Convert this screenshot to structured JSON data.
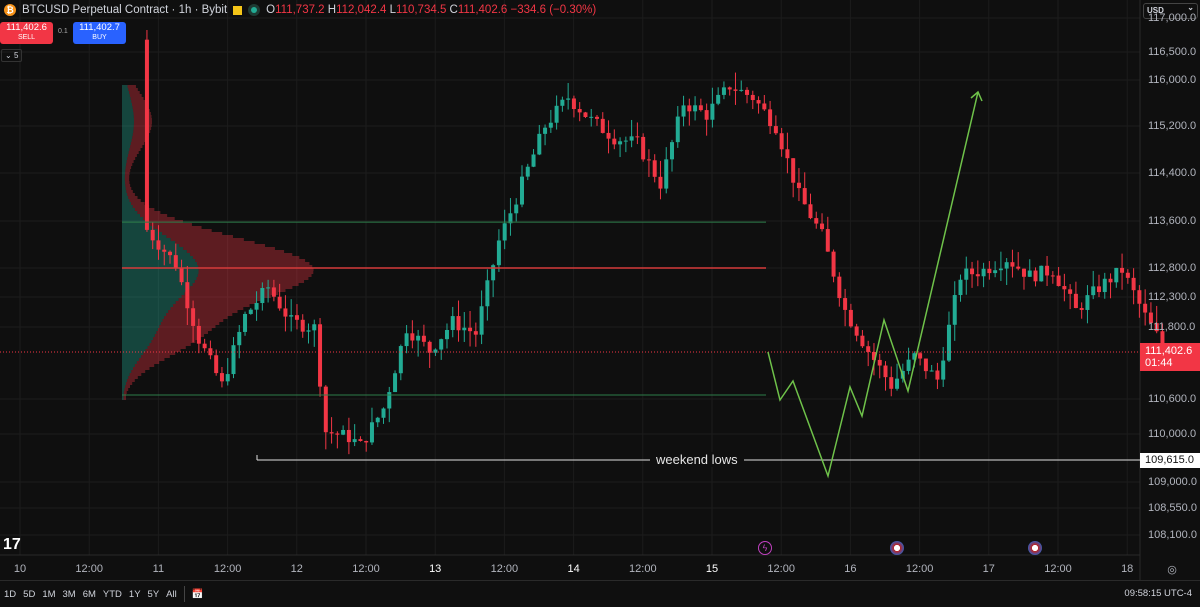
{
  "header": {
    "symbol": "BTCUSD Perpetual Contract · 1h · Bybit",
    "coin_glyph": "₿",
    "o_label": "O",
    "o": "111,737.2",
    "h_label": "H",
    "h": "112,042.4",
    "l_label": "L",
    "l": "110,734.5",
    "c_label": "C",
    "c": "111,402.6",
    "change": "−334.6 (−0.30%)"
  },
  "trade": {
    "sell_price": "111,402.6",
    "sell_label": "SELL",
    "buy_price": "111,402.7",
    "buy_label": "BUY",
    "qty": "0.1",
    "collapse": "5"
  },
  "currency": "USD",
  "price_axis": [
    "117,000.0",
    "116,500.0",
    "116,000.0",
    "115,200.0",
    "114,400.0",
    "113,600.0",
    "112,800.0",
    "112,300.0",
    "111,800.0",
    "110,600.0",
    "110,000.0",
    "109,000.0",
    "108,550.0",
    "108,100.0"
  ],
  "current_price": {
    "value": "111,402.6",
    "countdown": "01:44"
  },
  "weekend_low": {
    "value": "109,615.0",
    "label": "weekend lows"
  },
  "time_axis": [
    "10",
    "12:00",
    "11",
    "12:00",
    "12",
    "12:00",
    "13",
    "12:00",
    "14",
    "12:00",
    "15",
    "12:00",
    "16",
    "12:00",
    "17",
    "12:00",
    "18"
  ],
  "ranges": [
    "1D",
    "5D",
    "1M",
    "3M",
    "6M",
    "YTD",
    "1Y",
    "5Y",
    "All"
  ],
  "clock": "09:58:15 UTC-4",
  "colors": {
    "up": "#22ab94",
    "down": "#f23645",
    "projection": "#6fc24a"
  },
  "levels": {
    "value_area_high": 113550,
    "poc": 112780,
    "value_area_low": 110700
  },
  "price_path": [
    [
      16,
      116700
    ],
    [
      17,
      113400
    ],
    [
      22,
      112800
    ],
    [
      26,
      111500
    ],
    [
      30,
      110700
    ],
    [
      34,
      111900
    ],
    [
      38,
      112400
    ],
    [
      42,
      111800
    ],
    [
      46,
      111700
    ],
    [
      48,
      109900
    ],
    [
      52,
      109800
    ],
    [
      54,
      109650
    ],
    [
      58,
      110300
    ],
    [
      62,
      111700
    ],
    [
      66,
      111300
    ],
    [
      70,
      111800
    ],
    [
      74,
      111600
    ],
    [
      78,
      113200
    ],
    [
      82,
      114200
    ],
    [
      86,
      115200
    ],
    [
      90,
      115700
    ],
    [
      94,
      115300
    ],
    [
      98,
      115000
    ],
    [
      102,
      114900
    ],
    [
      106,
      114200
    ],
    [
      110,
      115600
    ],
    [
      114,
      115400
    ],
    [
      118,
      115900
    ],
    [
      122,
      115700
    ],
    [
      126,
      115200
    ],
    [
      130,
      114000
    ],
    [
      134,
      113300
    ],
    [
      138,
      112000
    ],
    [
      142,
      111300
    ],
    [
      146,
      110700
    ],
    [
      150,
      111200
    ],
    [
      154,
      110800
    ],
    [
      158,
      112600
    ],
    [
      162,
      112700
    ],
    [
      166,
      112900
    ],
    [
      170,
      112600
    ],
    [
      174,
      112700
    ],
    [
      178,
      112000
    ],
    [
      182,
      112400
    ],
    [
      186,
      112700
    ],
    [
      190,
      111900
    ],
    [
      193,
      111400
    ]
  ]
}
